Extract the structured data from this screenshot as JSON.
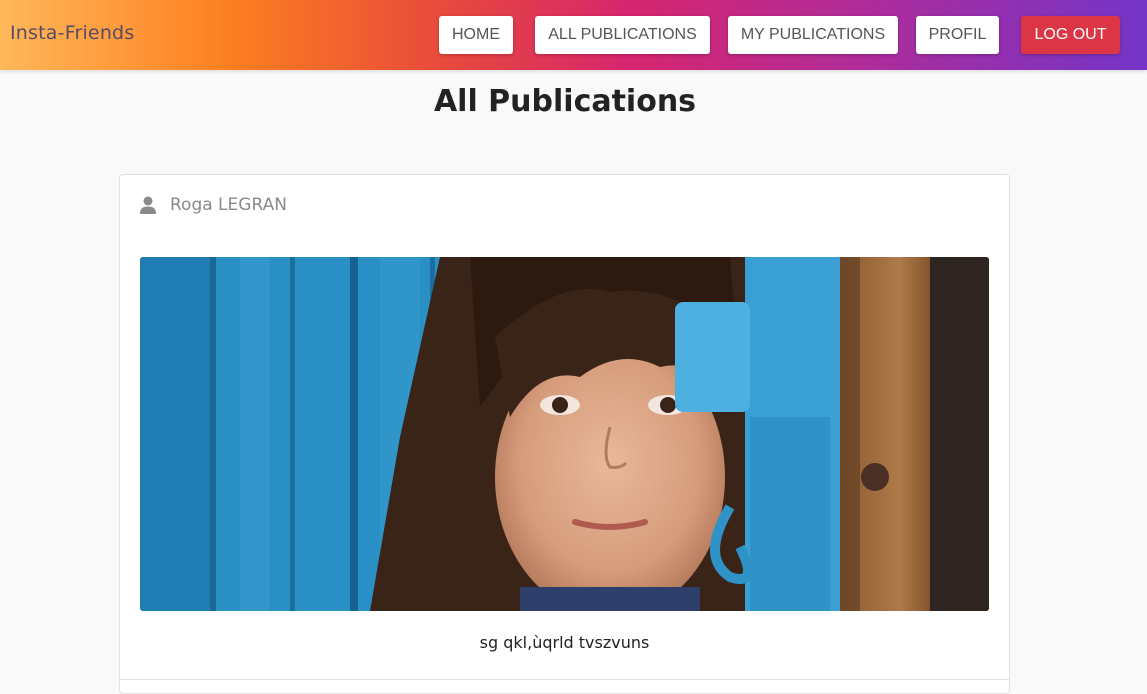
{
  "app": {
    "brand": "Insta-Friends"
  },
  "nav": {
    "home": "HOME",
    "all_publications": "ALL PUBLICATIONS",
    "my_publications": "MY PUBLICATIONS",
    "profil": "PROFIL",
    "logout": "LOG OUT"
  },
  "page": {
    "title": "All Publications"
  },
  "publication": {
    "author": "Roga LEGRAN",
    "caption": "sg qkl,ùqrld tvszvuns"
  },
  "colors": {
    "logout_button": "#dc3545",
    "header_gradient": [
      "#fdb85a",
      "#fd7f1f",
      "#d6256f",
      "#7434c8"
    ]
  }
}
